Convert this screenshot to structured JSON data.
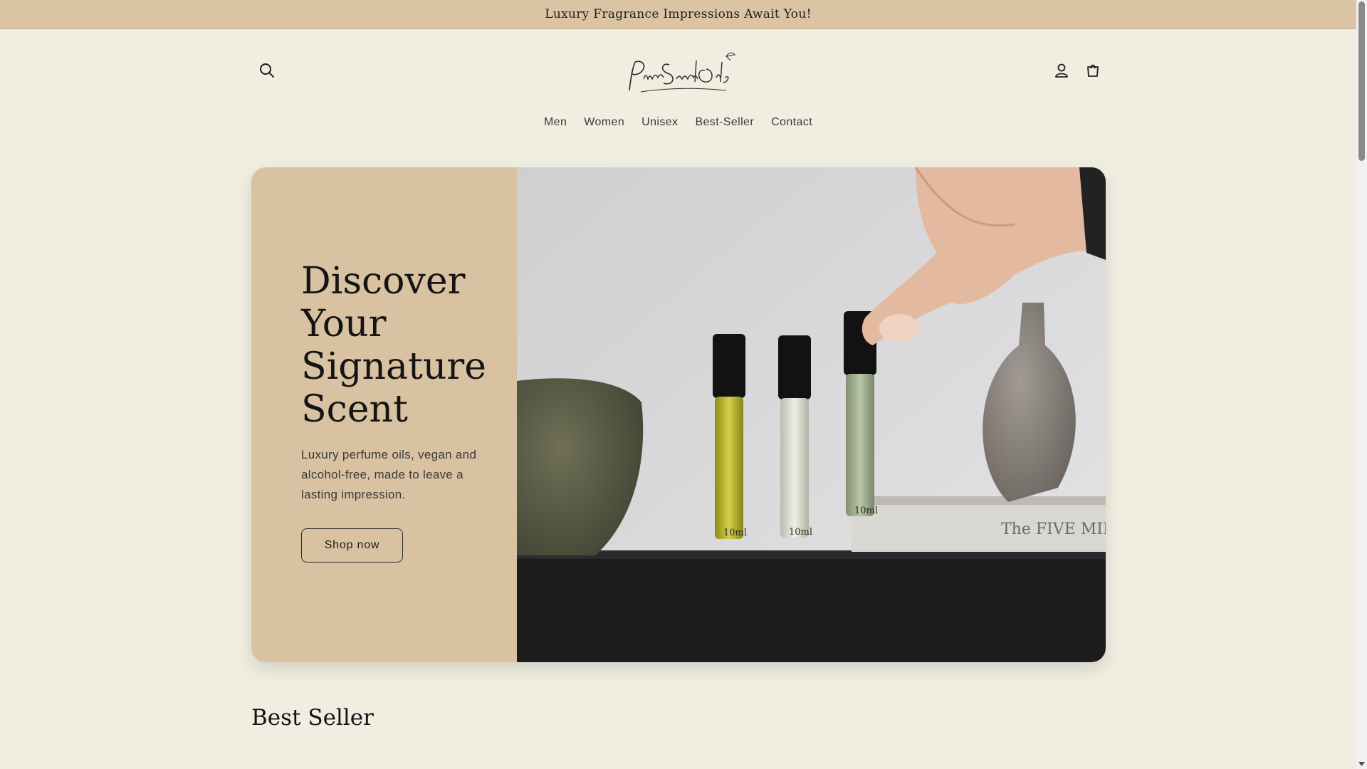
{
  "announcement": "Luxury Fragrance Impressions Await You!",
  "header": {
    "logo_text": "PureScentOils",
    "search_icon": "search-icon",
    "account_icon": "account-icon",
    "cart_icon": "cart-icon"
  },
  "nav": {
    "items": [
      "Men",
      "Women",
      "Unisex",
      "Best-Seller",
      "Contact"
    ]
  },
  "hero": {
    "title": "Discover Your Signature Scent",
    "subtitle": "Luxury perfume oils, vegan and alcohol-free, made to leave a lasting impression.",
    "button_label": "Shop now",
    "image_labels": [
      "10ml",
      "10ml",
      "10ml"
    ],
    "book_text": "The FIVE MINUT"
  },
  "section": {
    "title": "Best Seller"
  },
  "colors": {
    "background": "#f0eee0",
    "announcement_bar": "#dbc4a3",
    "hero_panel": "#d9c2a1",
    "text": "#1e1e1e"
  }
}
